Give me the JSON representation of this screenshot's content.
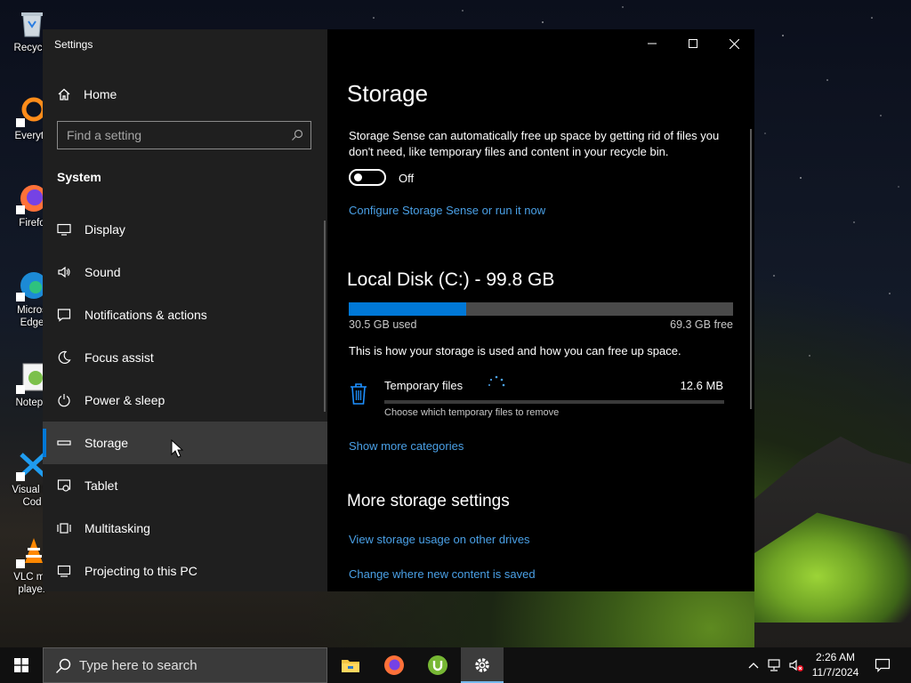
{
  "desktop": {
    "icons": [
      {
        "label": "Recycle",
        "icon": "recycle-bin-icon"
      },
      {
        "label": "Everyth",
        "icon": "everything-search-icon"
      },
      {
        "label": "Firefo",
        "icon": "firefox-icon"
      },
      {
        "label": "Micros Edge",
        "icon": "edge-icon"
      },
      {
        "label": "Notepa",
        "icon": "notepad-plus-plus-icon"
      },
      {
        "label": "Visual St Cod",
        "icon": "vscode-icon"
      },
      {
        "label": "VLC me player",
        "icon": "vlc-icon"
      }
    ]
  },
  "window": {
    "title": "Settings",
    "controls": {
      "minimize": "minimize-icon",
      "maximize": "maximize-icon",
      "close": "close-icon"
    }
  },
  "sidebar": {
    "home_label": "Home",
    "search_placeholder": "Find a setting",
    "section_title": "System",
    "items": [
      {
        "label": "Display",
        "icon": "display-icon"
      },
      {
        "label": "Sound",
        "icon": "sound-icon"
      },
      {
        "label": "Notifications & actions",
        "icon": "notifications-icon"
      },
      {
        "label": "Focus assist",
        "icon": "moon-icon"
      },
      {
        "label": "Power & sleep",
        "icon": "power-icon"
      },
      {
        "label": "Storage",
        "icon": "storage-icon",
        "selected": true
      },
      {
        "label": "Tablet",
        "icon": "tablet-icon"
      },
      {
        "label": "Multitasking",
        "icon": "multitasking-icon"
      },
      {
        "label": "Projecting to this PC",
        "icon": "projecting-icon"
      }
    ]
  },
  "storage": {
    "title": "Storage",
    "sense_description": "Storage Sense can automatically free up space by getting rid of files you don't need, like temporary files and content in your recycle bin.",
    "toggle_state": "Off",
    "configure_link": "Configure Storage Sense or run it now",
    "disk_title": "Local Disk (C:) - 99.8 GB",
    "used_label": "30.5 GB used",
    "free_label": "69.3 GB free",
    "used_fraction": 0.306,
    "usage_description": "This is how your storage is used and how you can free up space.",
    "temp_files": {
      "label": "Temporary files",
      "size": "12.6 MB",
      "sub": "Choose which temporary files to remove",
      "icon": "trash-icon"
    },
    "show_more_link": "Show more categories",
    "more_title": "More storage settings",
    "more_links": [
      "View storage usage on other drives",
      "Change where new content is saved"
    ]
  },
  "taskbar": {
    "search_placeholder": "Type here to search",
    "apps": [
      "file-explorer-icon",
      "firefox-icon",
      "utorrent-icon",
      "settings-icon"
    ],
    "time": "2:26 AM",
    "date": "11/7/2024"
  },
  "colors": {
    "accent": "#0078d7",
    "link": "#4aa0e6",
    "sidebar_bg": "#1f1f1f"
  }
}
